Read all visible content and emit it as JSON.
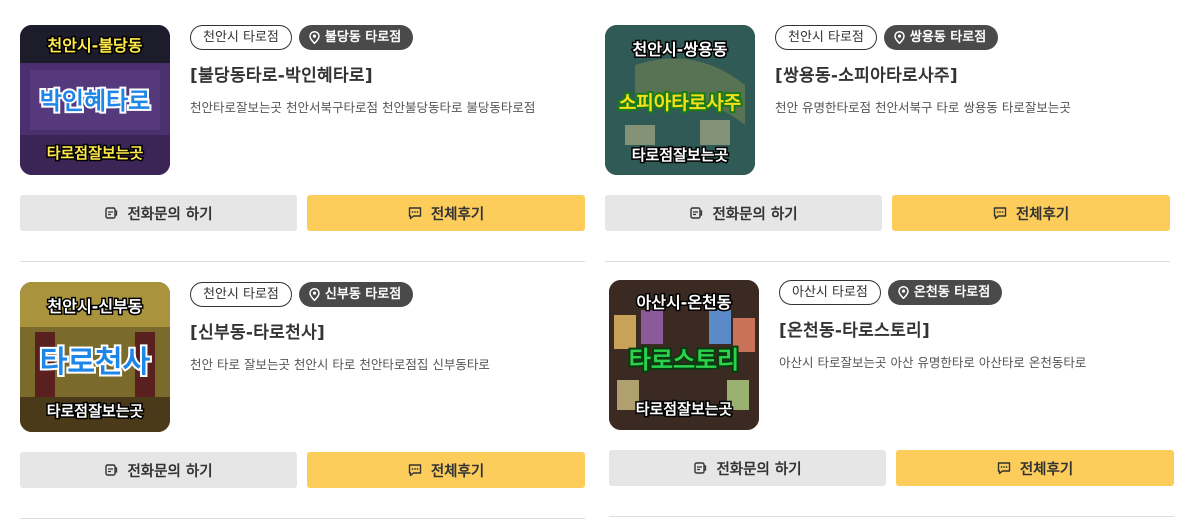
{
  "cards": [
    {
      "city_tag": "천안시 타로점",
      "shop_tag": "불당동 타로점",
      "title": "[불당동타로-박인혜타로]",
      "desc": "천안타로잘보는곳 천안서북구타로점 천안불당동타로 불당동타로점",
      "thumb": {
        "top": "천안시-불당동",
        "mid": "박인혜타로",
        "bottom": "타로점잘보는곳",
        "mid_color": "#1e86e8",
        "bg": "#4b2f6e"
      },
      "call_label": "전화문의 하기",
      "review_label": "전체후기"
    },
    {
      "city_tag": "천안시 타로점",
      "shop_tag": "쌍용동 타로점",
      "title": "[쌍용동-소피아타로사주]",
      "desc": "천안 유명한타로점 천안서북구 타로 쌍용동 타로잘보는곳",
      "thumb": {
        "top": "천안시-쌍용동",
        "mid": "소피아타로사주",
        "bottom": "타로점잘보는곳",
        "mid_color": "#f5e11a",
        "bg": "#2f5a55"
      },
      "call_label": "전화문의 하기",
      "review_label": "전체후기"
    },
    {
      "city_tag": "천안시 타로점",
      "shop_tag": "신부동 타로점",
      "title": "[신부동-타로천사]",
      "desc": "천안 타로 잘보는곳 천안시 타로 천안타로점집 신부동타로",
      "thumb": {
        "top": "천안시-신부동",
        "mid": "타로천사",
        "bottom": "타로점잘보는곳",
        "mid_color": "#1e86e8",
        "bg": "#7a6a2c"
      },
      "call_label": "전화문의 하기",
      "review_label": "전체후기"
    },
    {
      "city_tag": "아산시 타로점",
      "shop_tag": "온천동 타로점",
      "title": "[온천동-타로스토리]",
      "desc": "아산시 타로잘보는곳 아산 유명한타로 아산타로 온천동타로",
      "thumb": {
        "top": "아산시-온천동",
        "mid": "타로스토리",
        "bottom": "타로점잘보는곳",
        "mid_color": "#2bd24b",
        "bg": "#3a2a22"
      },
      "call_label": "전화문의 하기",
      "review_label": "전체후기"
    }
  ],
  "icons": {
    "pin": "map-pin-icon",
    "call": "phone-icon",
    "review": "chat-bubble-icon"
  },
  "colors": {
    "review_button": "#fdcd5c",
    "call_button": "#e6e6e6",
    "shop_tag": "#4a4a4a"
  }
}
